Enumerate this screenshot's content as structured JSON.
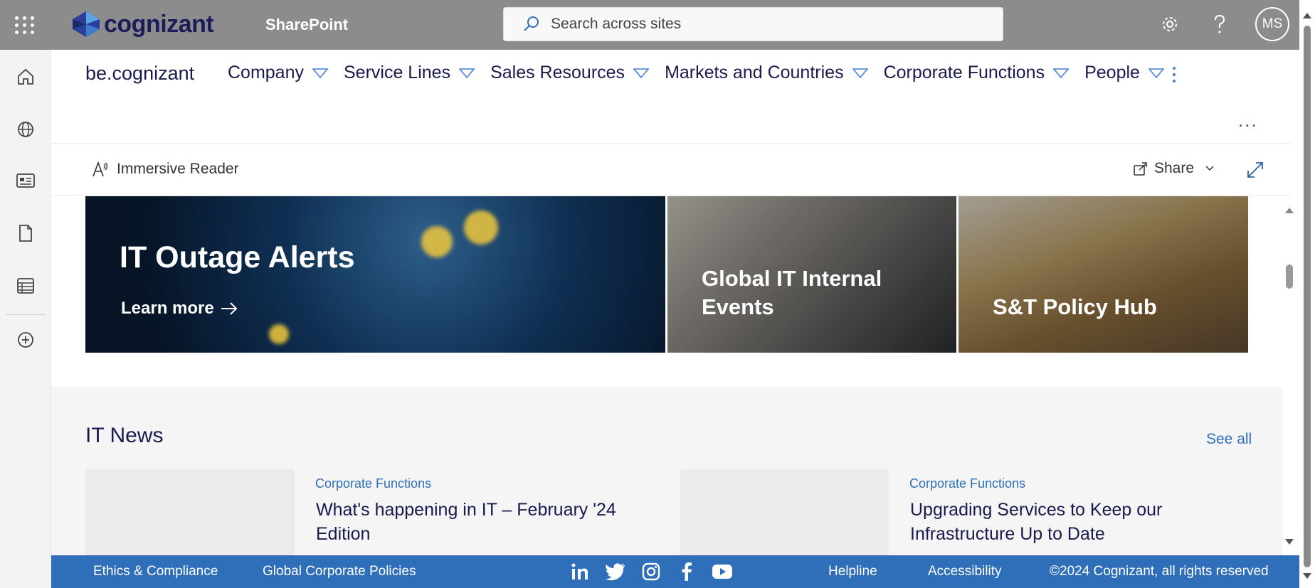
{
  "suitebar": {
    "logo_text": "cognizant",
    "app_name": "SharePoint",
    "search_placeholder": "Search across sites",
    "avatar_initials": "MS",
    "icons": [
      "waffle-icon",
      "gear-icon",
      "help-icon"
    ]
  },
  "appbar": {
    "items": [
      "home-icon",
      "globe-icon",
      "news-icon",
      "file-icon",
      "list-icon",
      "add-icon"
    ]
  },
  "site": {
    "name": "be.cognizant",
    "nav": [
      {
        "label": "Company"
      },
      {
        "label": "Service Lines"
      },
      {
        "label": "Sales Resources"
      },
      {
        "label": "Markets and Countries"
      },
      {
        "label": "Corporate Functions"
      },
      {
        "label": "People"
      }
    ],
    "more": "..."
  },
  "commandbar": {
    "immersive_reader": "Immersive Reader",
    "share": "Share"
  },
  "hero": {
    "main_title": "IT Outage Alerts",
    "main_link": "Learn more",
    "tile2_title": "Global IT Internal Events",
    "tile3_title": "S&T Policy Hub"
  },
  "news": {
    "title": "IT News",
    "see_all": "See all",
    "cards": [
      {
        "category": "Corporate Functions",
        "headline": "What's happening in IT – February '24 Edition"
      },
      {
        "category": "Corporate Functions",
        "headline": "Upgrading Services to Keep our Infrastructure Up to Date"
      }
    ]
  },
  "footer": {
    "ethics": "Ethics & Compliance",
    "policies": "Global Corporate Policies",
    "helpline": "Helpline",
    "accessibility": "Accessibility",
    "copyright": "©2024 Cognizant, all rights reserved",
    "social": [
      "linkedin-icon",
      "twitter-icon",
      "instagram-icon",
      "facebook-icon",
      "youtube-icon"
    ]
  },
  "colors": {
    "suitebar_bg": "#8c8c8c",
    "brand_navy": "#1a1a4e",
    "link_blue": "#2f6fba",
    "footer_bg": "#2f6fba"
  }
}
